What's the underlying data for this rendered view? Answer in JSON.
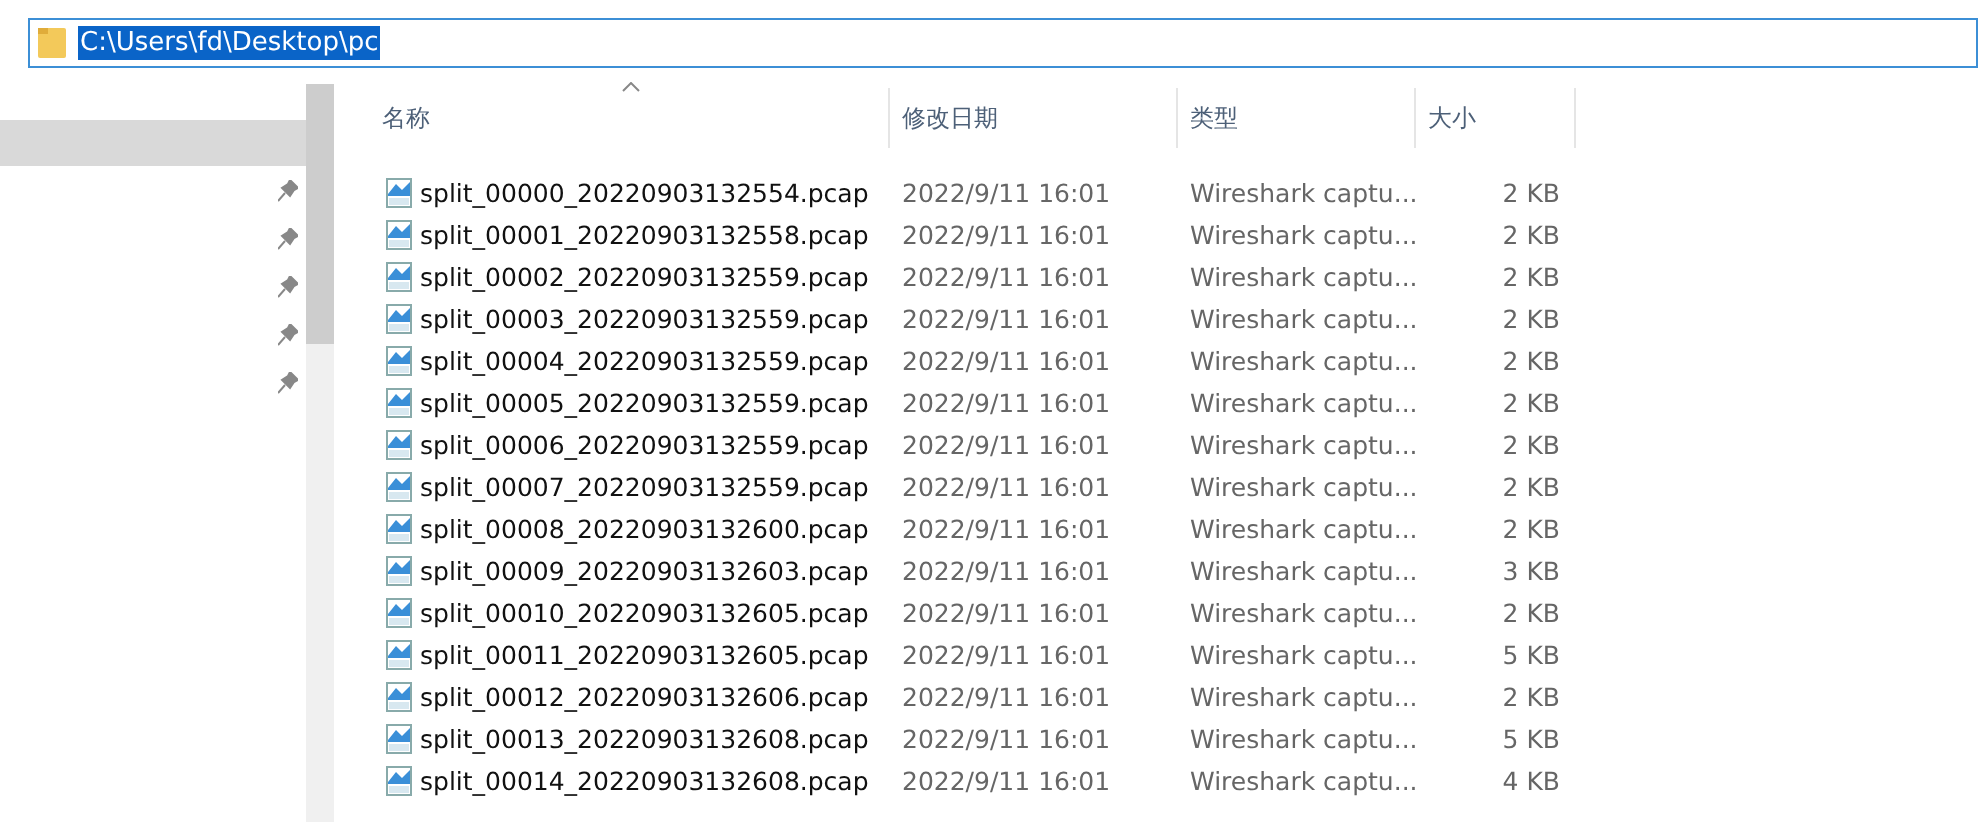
{
  "address_bar": {
    "path": "C:\\Users\\fd\\Desktop\\pc",
    "selected": true
  },
  "sidebar": {
    "items": [
      {
        "selected": true,
        "pinned": false
      },
      {
        "selected": false,
        "pinned": true
      },
      {
        "selected": false,
        "pinned": true
      },
      {
        "selected": false,
        "pinned": true
      },
      {
        "selected": false,
        "pinned": true
      },
      {
        "selected": false,
        "pinned": true
      }
    ]
  },
  "file_list": {
    "columns": [
      {
        "label": "名称",
        "sorted": true
      },
      {
        "label": "修改日期",
        "sorted": false
      },
      {
        "label": "类型",
        "sorted": false
      },
      {
        "label": "大小",
        "sorted": false
      }
    ],
    "rows": [
      {
        "name": "split_00000_20220903132554.pcap",
        "date": "2022/9/11 16:01",
        "type": "Wireshark captu...",
        "size": "2 KB"
      },
      {
        "name": "split_00001_20220903132558.pcap",
        "date": "2022/9/11 16:01",
        "type": "Wireshark captu...",
        "size": "2 KB"
      },
      {
        "name": "split_00002_20220903132559.pcap",
        "date": "2022/9/11 16:01",
        "type": "Wireshark captu...",
        "size": "2 KB"
      },
      {
        "name": "split_00003_20220903132559.pcap",
        "date": "2022/9/11 16:01",
        "type": "Wireshark captu...",
        "size": "2 KB"
      },
      {
        "name": "split_00004_20220903132559.pcap",
        "date": "2022/9/11 16:01",
        "type": "Wireshark captu...",
        "size": "2 KB"
      },
      {
        "name": "split_00005_20220903132559.pcap",
        "date": "2022/9/11 16:01",
        "type": "Wireshark captu...",
        "size": "2 KB"
      },
      {
        "name": "split_00006_20220903132559.pcap",
        "date": "2022/9/11 16:01",
        "type": "Wireshark captu...",
        "size": "2 KB"
      },
      {
        "name": "split_00007_20220903132559.pcap",
        "date": "2022/9/11 16:01",
        "type": "Wireshark captu...",
        "size": "2 KB"
      },
      {
        "name": "split_00008_20220903132600.pcap",
        "date": "2022/9/11 16:01",
        "type": "Wireshark captu...",
        "size": "2 KB"
      },
      {
        "name": "split_00009_20220903132603.pcap",
        "date": "2022/9/11 16:01",
        "type": "Wireshark captu...",
        "size": "3 KB"
      },
      {
        "name": "split_00010_20220903132605.pcap",
        "date": "2022/9/11 16:01",
        "type": "Wireshark captu...",
        "size": "2 KB"
      },
      {
        "name": "split_00011_20220903132605.pcap",
        "date": "2022/9/11 16:01",
        "type": "Wireshark captu...",
        "size": "5 KB"
      },
      {
        "name": "split_00012_20220903132606.pcap",
        "date": "2022/9/11 16:01",
        "type": "Wireshark captu...",
        "size": "2 KB"
      },
      {
        "name": "split_00013_20220903132608.pcap",
        "date": "2022/9/11 16:01",
        "type": "Wireshark captu...",
        "size": "5 KB"
      },
      {
        "name": "split_00014_20220903132608.pcap",
        "date": "2022/9/11 16:01",
        "type": "Wireshark captu...",
        "size": "4 KB"
      }
    ]
  }
}
